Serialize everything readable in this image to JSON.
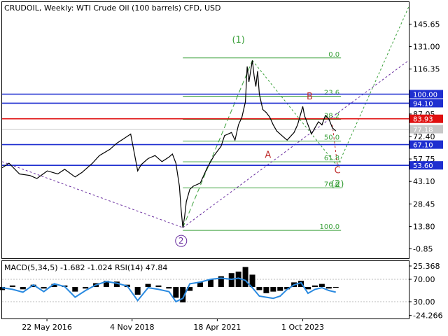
{
  "header": {
    "symbol": "CRUDOIL",
    "timeframe": "Weekly:",
    "description": "WTI Crude Oil (100 barrels) CFD, USD"
  },
  "chart_data": {
    "type": "line",
    "price_axis": {
      "ticks": [
        145.65,
        131.0,
        116.35,
        87.05,
        72.4,
        57.75,
        43.1,
        28.45,
        13.8,
        -0.85
      ],
      "range": [
        -7.0,
        160.0
      ]
    },
    "time_axis": {
      "ticks": [
        "22 May 2016",
        "4 Nov 2018",
        "18 Apr 2021",
        "1 Oct 2023"
      ],
      "tick_years": [
        2016.39,
        2018.84,
        2021.29,
        2023.75
      ],
      "range": [
        2015.1,
        2026.8
      ]
    },
    "price_series": {
      "name": "",
      "x": [
        2015.1,
        2015.3,
        2015.6,
        2015.9,
        2016.1,
        2016.4,
        2016.7,
        2016.9,
        2017.2,
        2017.4,
        2017.7,
        2017.9,
        2018.2,
        2018.4,
        2018.6,
        2018.8,
        2018.9,
        2019.0,
        2019.1,
        2019.3,
        2019.5,
        2019.7,
        2019.9,
        2020.0,
        2020.1,
        2020.2,
        2020.25,
        2020.3,
        2020.35,
        2020.4,
        2020.5,
        2020.6,
        2020.8,
        2020.9,
        2021.0,
        2021.2,
        2021.4,
        2021.5,
        2021.7,
        2021.8,
        2021.9,
        2022.0,
        2022.1,
        2022.15,
        2022.2,
        2022.3,
        2022.35,
        2022.4,
        2022.45,
        2022.5,
        2022.6,
        2022.7,
        2022.8,
        2022.9,
        2023.0,
        2023.2,
        2023.3,
        2023.5,
        2023.6,
        2023.7,
        2023.75,
        2023.8,
        2023.9,
        2024.0,
        2024.1,
        2024.2,
        2024.3,
        2024.4,
        2024.5,
        2024.6,
        2024.7
      ],
      "y": [
        52,
        55,
        48,
        47,
        45,
        50,
        48,
        51,
        46,
        49,
        55,
        60,
        64,
        68,
        71,
        74,
        62,
        50,
        54,
        58,
        60,
        56,
        59,
        61,
        55,
        40,
        25,
        13,
        20,
        30,
        38,
        40,
        42,
        47,
        52,
        60,
        66,
        73,
        75,
        70,
        80,
        85,
        95,
        118,
        108,
        122,
        112,
        105,
        115,
        100,
        90,
        88,
        85,
        80,
        76,
        72,
        70,
        75,
        80,
        88,
        92,
        86,
        80,
        74,
        78,
        82,
        80,
        86,
        84,
        78,
        76
      ]
    },
    "levels": [
      {
        "price": 100.0,
        "label": "100.00",
        "color": "#1f2fd0"
      },
      {
        "price": 94.1,
        "label": "94.10",
        "color": "#1f2fd0"
      },
      {
        "price": 83.93,
        "label": "83.93",
        "color": "#e01010"
      },
      {
        "price": 77.18,
        "label": "77.18",
        "color": "#c8c8c8"
      },
      {
        "price": 67.1,
        "label": "67.10",
        "color": "#1f2fd0"
      },
      {
        "price": 53.6,
        "label": "53.60",
        "color": "#1f2fd0"
      }
    ],
    "fibonacci": {
      "x_start": 2020.3,
      "x_end": 2024.85,
      "color": "#3aa03a",
      "levels": [
        {
          "label": "0.0",
          "price": 123.6
        },
        {
          "label": "23.6",
          "price": 98.6
        },
        {
          "label": "38.2",
          "price": 83.6
        },
        {
          "label": "50.0",
          "price": 69.4
        },
        {
          "label": "61.8",
          "price": 55.9
        },
        {
          "label": "76.0",
          "price": 38.9
        },
        {
          "label": "100.0",
          "price": 11.2
        }
      ]
    },
    "wave_labels": [
      {
        "text": "(1)",
        "x": 2021.9,
        "price": 133.5,
        "color": "#3aa03a"
      },
      {
        "text": "2",
        "x": 2020.25,
        "price": 2.5,
        "color": "#6a2fa0",
        "circled": true
      },
      {
        "text": "A",
        "x": 2022.75,
        "price": 58.5,
        "color": "#c03030"
      },
      {
        "text": "B",
        "x": 2023.95,
        "price": 96.5,
        "color": "#c03030"
      },
      {
        "text": "C",
        "x": 2024.75,
        "price": 48.5,
        "color": "#c03030"
      },
      {
        "text": "(2)",
        "x": 2024.75,
        "price": 39.5,
        "color": "#3aa03a"
      }
    ],
    "indicator": {
      "name": "MACD(5,34,5) -1.682 -1.024 RSI(14) 47.84",
      "ticks": [
        25.368,
        70.0,
        30.0,
        -24.266
      ],
      "histogram_x": [
        2015.1,
        2015.4,
        2015.7,
        2016.0,
        2016.3,
        2016.6,
        2016.9,
        2017.2,
        2017.5,
        2017.8,
        2018.1,
        2018.4,
        2018.7,
        2019.0,
        2019.3,
        2019.6,
        2019.9,
        2020.1,
        2020.3,
        2020.5,
        2020.8,
        2021.1,
        2021.4,
        2021.7,
        2021.9,
        2022.1,
        2022.3,
        2022.5,
        2022.7,
        2022.9,
        2023.1,
        2023.3,
        2023.5,
        2023.7,
        2023.9,
        2024.1,
        2024.3,
        2024.5,
        2024.7
      ],
      "histogram_y": [
        -4,
        2,
        -3,
        3,
        -2,
        4,
        2,
        -6,
        -2,
        5,
        8,
        7,
        3,
        -10,
        4,
        2,
        -2,
        -14,
        -20,
        -5,
        6,
        10,
        14,
        18,
        20,
        26,
        16,
        -4,
        -8,
        -6,
        -5,
        -3,
        6,
        8,
        -3,
        2,
        4,
        -2,
        -1
      ],
      "rsi_y": [
        55,
        52,
        47,
        60,
        48,
        62,
        57,
        38,
        50,
        60,
        66,
        63,
        58,
        32,
        55,
        52,
        48,
        30,
        36,
        62,
        65,
        70,
        72,
        70,
        72,
        68,
        55,
        40,
        38,
        36,
        40,
        52,
        60,
        64,
        45,
        52,
        55,
        50,
        47
      ]
    }
  }
}
